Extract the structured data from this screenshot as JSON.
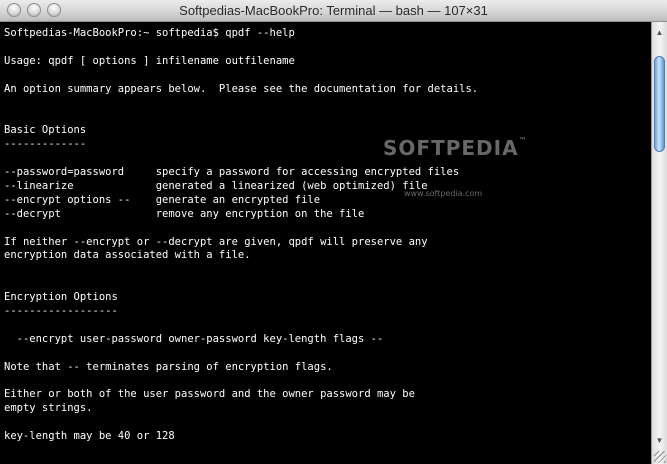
{
  "window": {
    "title": "Softpedias-MacBookPro: Terminal — bash — 107×31",
    "buttons": [
      "close",
      "minimize",
      "zoom"
    ]
  },
  "terminal": {
    "lines": [
      "Softpedias-MacBookPro:~ softpedia$ qpdf --help",
      "",
      "Usage: qpdf [ options ] infilename outfilename",
      "",
      "An option summary appears below.  Please see the documentation for details.",
      "",
      "",
      "Basic Options",
      "-------------",
      "",
      "--password=password     specify a password for accessing encrypted files",
      "--linearize             generated a linearized (web optimized) file",
      "--encrypt options --    generate an encrypted file",
      "--decrypt               remove any encryption on the file",
      "",
      "If neither --encrypt or --decrypt are given, qpdf will preserve any",
      "encryption data associated with a file.",
      "",
      "",
      "Encryption Options",
      "------------------",
      "",
      "  --encrypt user-password owner-password key-length flags --",
      "",
      "Note that -- terminates parsing of encryption flags.",
      "",
      "Either or both of the user password and the owner password may be",
      "empty strings.",
      "",
      "key-length may be 40 or 128"
    ]
  },
  "watermark": {
    "brand": "SOFTPEDIA",
    "tm": "™",
    "url": "www.softpedia.com"
  },
  "icons": {
    "scroll_up": "▲",
    "scroll_down": "▼"
  }
}
